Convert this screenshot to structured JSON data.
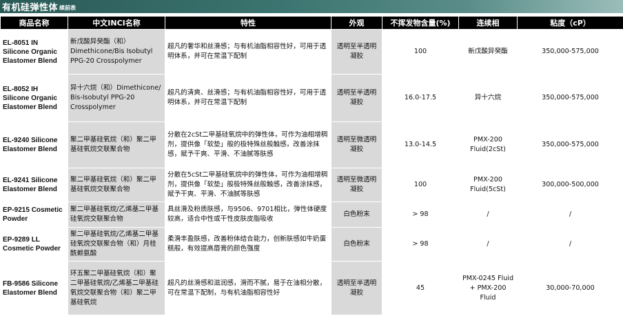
{
  "header": {
    "title": "有机硅弹性体",
    "subtitle": "续前表"
  },
  "columns": [
    "商品名称",
    "中文INCI名称",
    "特性",
    "外观",
    "不挥发物含量(%)",
    "连续相",
    "粘度（cP）"
  ],
  "rows": [
    {
      "name": "EL-8051 IN Silicone Organic Elastomer Blend",
      "inci": "新戊酸异癸酯（和）Dimethicone/Bis Isobutyl PPG-20 Crosspolymer",
      "feature": "超凡的奢华和丝滑感；与有机油脂相容性好，可用于透明体系，并可在常温下配制",
      "appearance": "透明至半透明凝胶",
      "nonvolatile": "100",
      "continuous": "新戊酸异癸酯",
      "viscosity": "350,000-575,000"
    },
    {
      "name": "EL-8052 IH Silicone Organic Elastomer Blend",
      "inci": "异十六烷（和）Dimethicone/ Bis-Isobutyl PPG-20 Crosspolymer",
      "feature": "超凡的清爽、丝滑感；与有机油脂相容性好，可用于透明体系，并可在常温下配制",
      "appearance": "透明至半透明凝胶",
      "nonvolatile": "16.0-17.5",
      "continuous": "异十六烷",
      "viscosity": "350,000-575,000"
    },
    {
      "name": "EL-9240 Silicone Elastomer Blend",
      "inci": "聚二甲基硅氧烷（和）聚二甲基硅氧烷交联聚合物",
      "feature": "分散在2cSt二甲基硅氧烷中的弹性体，可作为油相增稠剂，提供像「软垫」般的极特殊丝般触感，改善涂抹感，赋予干爽、平滑、不油腻等肤感",
      "appearance": "透明至微透明凝胶",
      "nonvolatile": "13.0-14.5",
      "continuous": "PMX-200 Fluid(2cSt)",
      "viscosity": "350,000-575,000"
    },
    {
      "name": "EL-9241 Silicone Elastomer Blend",
      "inci": "聚二甲基硅氧烷（和）聚二甲基硅氧烷交联聚合物",
      "feature": "分散在5cSt二甲基硅氧烷中的弹性体，可作为油相增稠剂，提供像「软垫」般极特殊丝般触感，改善涂抹感，赋予干爽、平滑、不油腻等肤感",
      "appearance": "透明至微透明凝胶",
      "nonvolatile": "100",
      "continuous": "PMX-200 Fluid(5cSt)",
      "viscosity": "300,000-500,000"
    },
    {
      "name": "EP-9215 Cosmetic Powder",
      "inci": "聚二甲基硅氧烷/乙烯基二甲基硅氧烷交联聚合物",
      "feature": "具丝滑及粉质肤感，与9506、9701相比，弹性体硬度较高，适合中性或干性皮肤皮脂吸收",
      "appearance": "白色粉末",
      "nonvolatile": "> 98",
      "continuous": "/",
      "viscosity": "/"
    },
    {
      "name": "EP-9289 LL Cosmetic Powder",
      "inci": "聚二甲基硅氧烷/乙烯基二甲基硅氧烷交联聚合物（和）月桂酰赖氨酸",
      "feature": "柔滑丰盈肤感，改善粉体结合能力，创新肤感如牛奶蛋糕般，有效提高唇膏的颜色强度",
      "appearance": "白色粉末",
      "nonvolatile": "> 98",
      "continuous": "/",
      "viscosity": "/"
    },
    {
      "name": "FB-9586 Silicone Elastomer Blend",
      "inci": "环五聚二甲基硅氧烷（和）聚二甲基硅氧烷/乙烯基二甲基硅氧烷交联聚合物（和）聚二甲基硅氧烷",
      "feature": "超凡的丝滑感和滋润感，滑而不腻，易于在油相分散，可在常温下配制，与有机油脂相容性好",
      "appearance": "透明至半透明凝胶",
      "nonvolatile": "45",
      "continuous": "PMX-0245 Fluid + PMX-200 Fluid",
      "viscosity": "30,000-70,000"
    }
  ]
}
